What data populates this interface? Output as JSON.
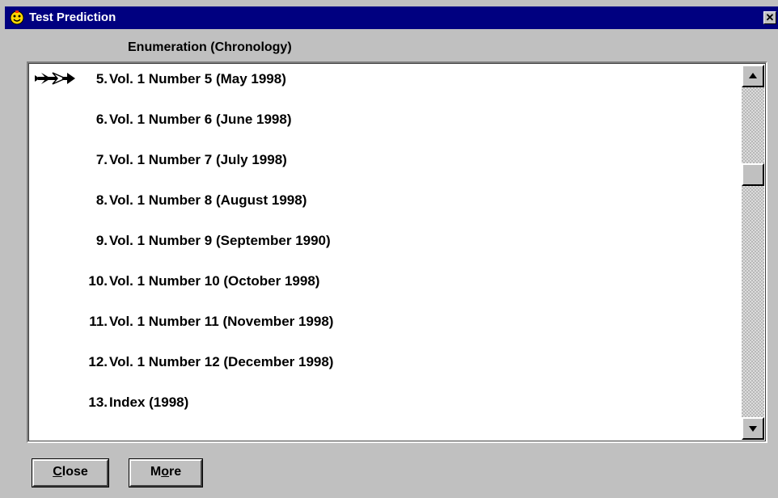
{
  "window": {
    "title": "Test Prediction",
    "close_glyph": "✕"
  },
  "list": {
    "column_header": "Enumeration (Chronology)",
    "items": [
      {
        "number": "5.",
        "text": "Vol. 1 Number 5 (May 1998)",
        "selected": true
      },
      {
        "number": "6.",
        "text": "Vol. 1 Number 6 (June 1998)"
      },
      {
        "number": "7.",
        "text": "Vol. 1 Number 7 (July 1998)"
      },
      {
        "number": "8.",
        "text": "Vol. 1 Number 8 (August 1998)"
      },
      {
        "number": "9.",
        "text": "Vol. 1 Number 9 (September 1990)"
      },
      {
        "number": "10.",
        "text": "Vol. 1 Number 10 (October 1998)"
      },
      {
        "number": "11.",
        "text": "Vol. 1 Number 11 (November 1998)"
      },
      {
        "number": "12.",
        "text": "Vol. 1 Number 12 (December 1998)"
      },
      {
        "number": "13.",
        "text": "Index  (1998)"
      }
    ]
  },
  "buttons": {
    "close_mnemonic": "C",
    "close_rest": "lose",
    "more_first": "M",
    "more_mnemonic": "o",
    "more_rest": "re"
  },
  "colors": {
    "titlebar": "#000080",
    "face": "#c0c0c0",
    "list_bg": "#ffffff"
  }
}
